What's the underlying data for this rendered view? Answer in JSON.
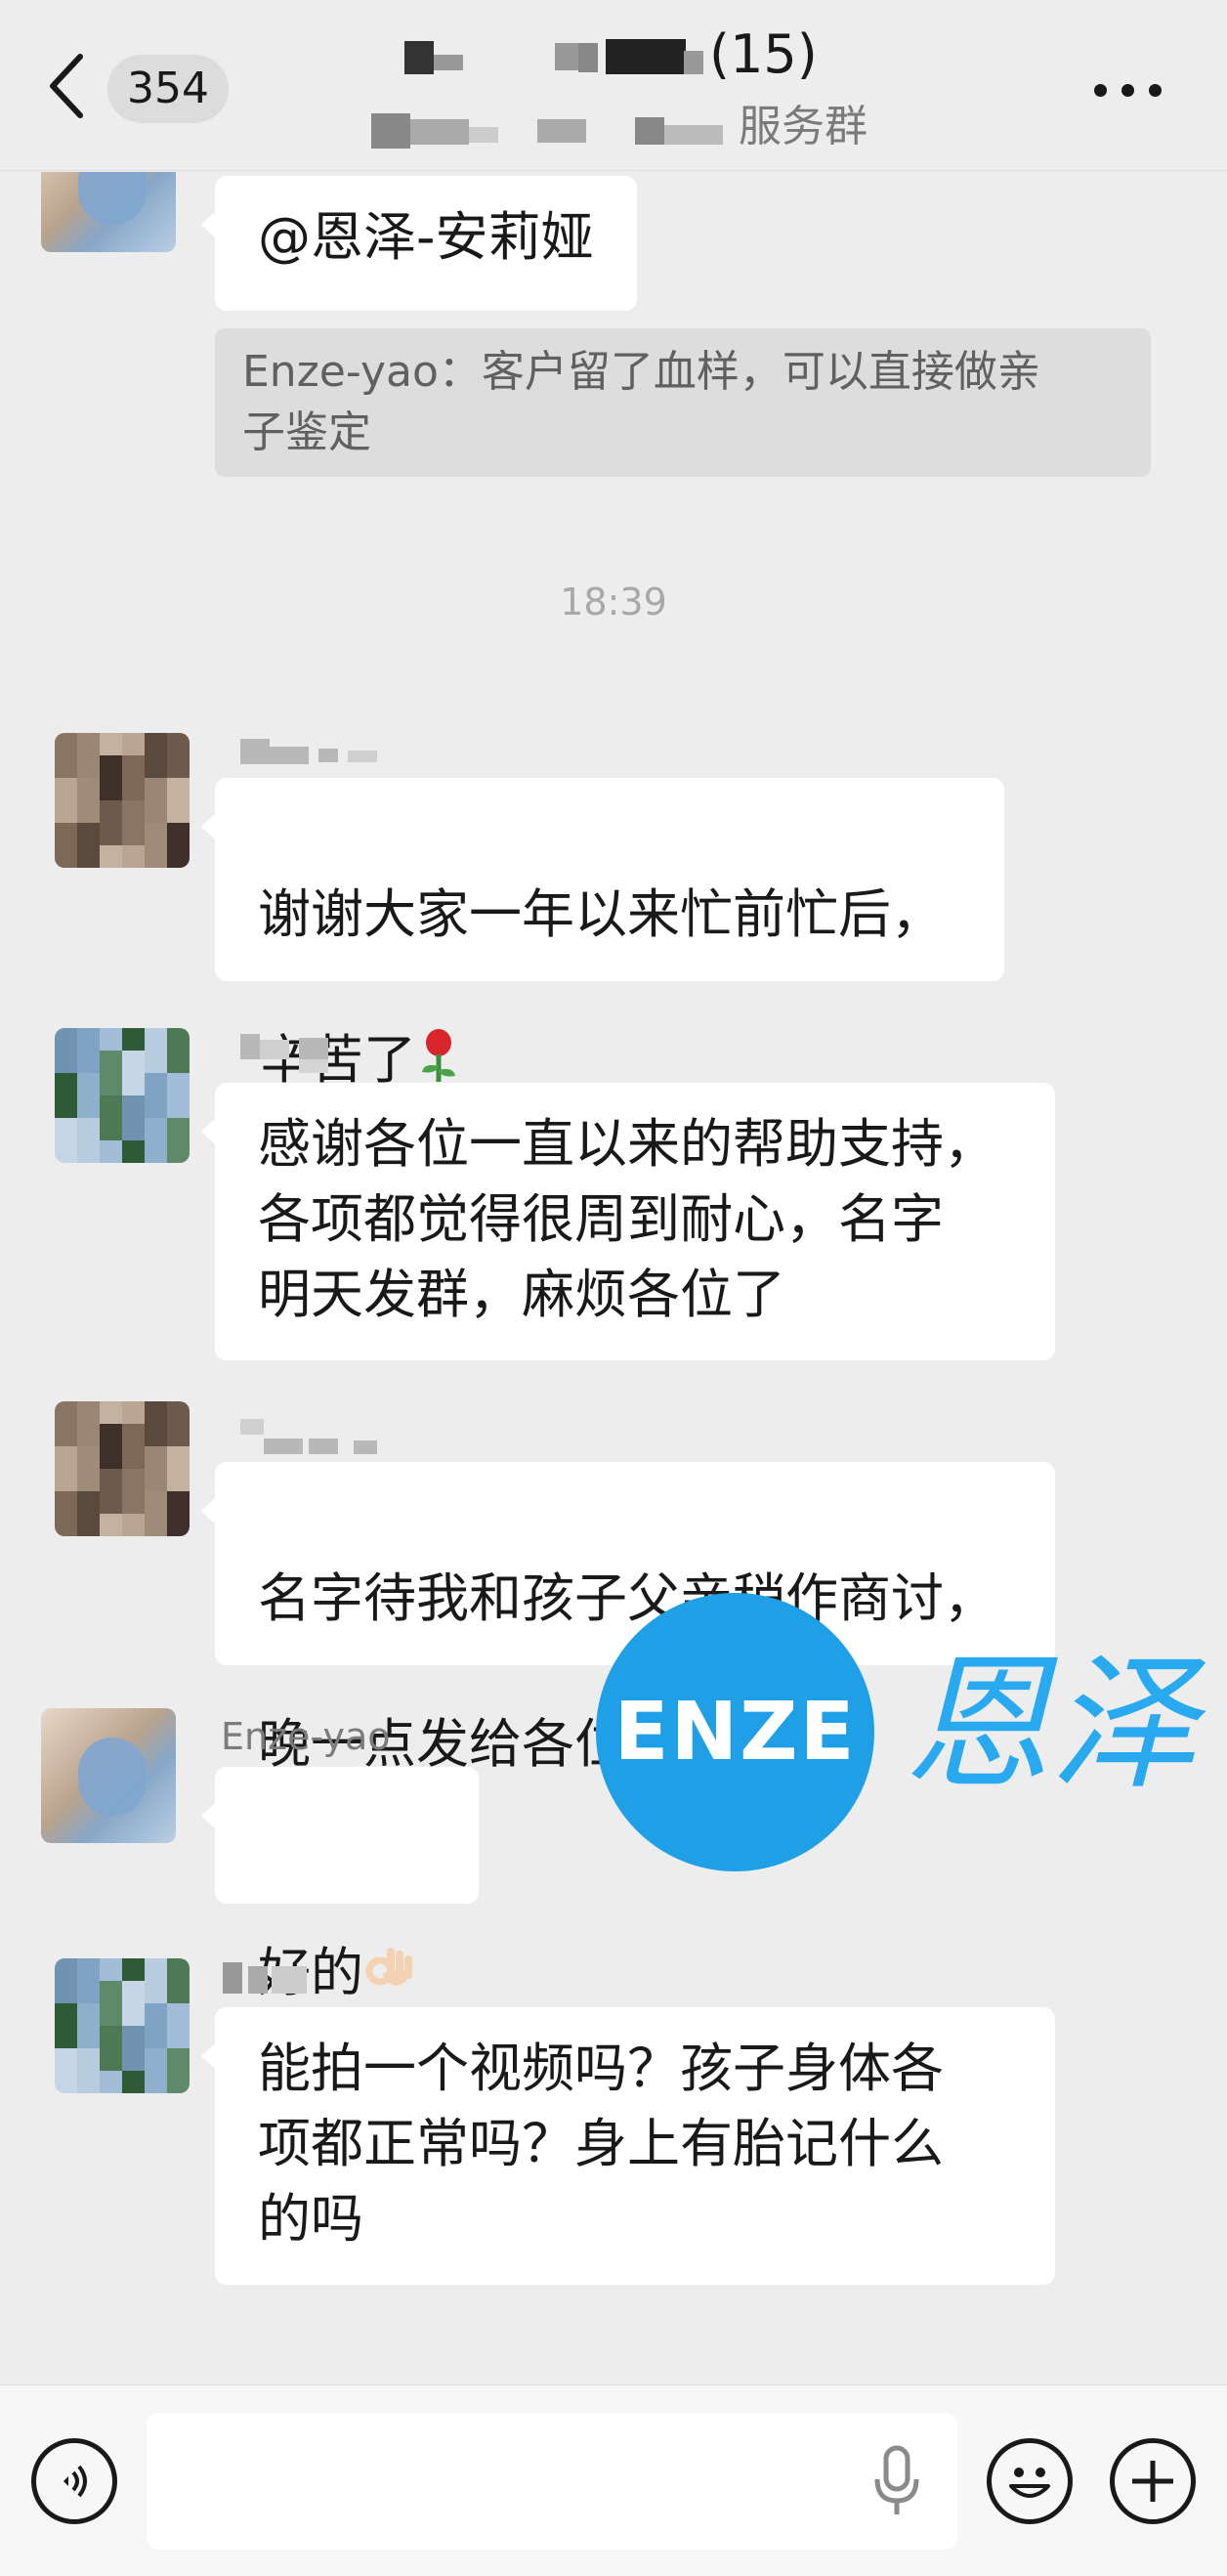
{
  "header": {
    "back_badge": "354",
    "title_count": "(15)",
    "subtitle_tail": "服务群"
  },
  "messages": [
    {
      "id": "m1",
      "sender": "",
      "text": "@恩泽-安莉娅",
      "quote": "Enze-yao：客户留了血样，可以直接做亲\n子鉴定"
    },
    {
      "id": "ts1",
      "timestamp": "18:39"
    },
    {
      "id": "m2",
      "sender": "",
      "text": "谢谢大家一年以来忙前忙后，\n辛苦了",
      "emoji": "rose"
    },
    {
      "id": "m3",
      "sender": "",
      "text": "感谢各位一直以来的帮助支持，\n各项都觉得很周到耐心，名字\n明天发群，麻烦各位了"
    },
    {
      "id": "m4",
      "sender": "",
      "text": "名字待我和孩子父亲稍作商讨，\n晚一点发给各位",
      "emoji": "rose"
    },
    {
      "id": "m5",
      "sender": "Enze-yao",
      "text": "好的",
      "emoji": "ok-hand"
    },
    {
      "id": "m6",
      "sender": "",
      "text": "能拍一个视频吗？孩子身体各\n项都正常吗？身上有胎记什么\n的吗"
    }
  ],
  "watermark": {
    "logo": "ENZE",
    "text": "恩泽"
  },
  "input_bar": {
    "placeholder": "",
    "icons": [
      "voice-icon",
      "mic-icon",
      "emoji-icon",
      "plus-icon"
    ]
  },
  "colors": {
    "background": "#ededed",
    "bubble": "#ffffff",
    "quote": "#dddddd",
    "watermark_blue": "#1f9fe6"
  }
}
